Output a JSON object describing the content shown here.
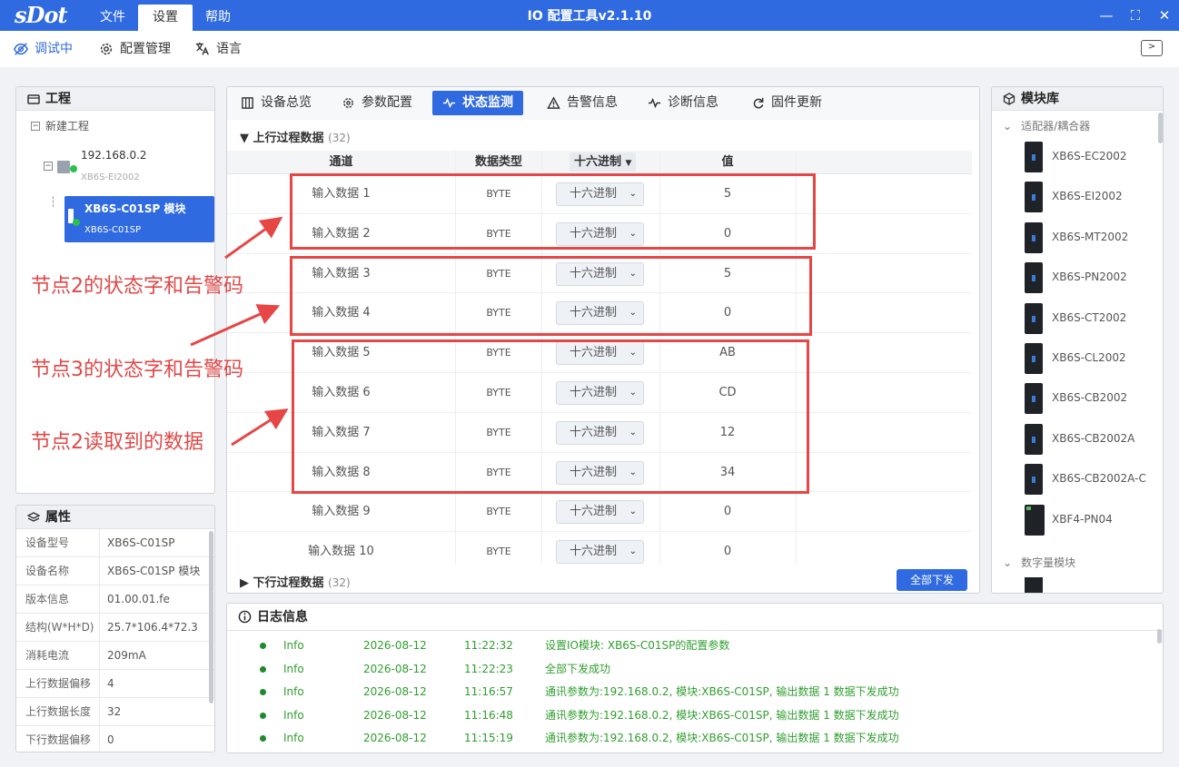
{
  "app": {
    "logo": "sDot",
    "title": "IO 配置工具v2.1.10",
    "menu": [
      "文件",
      "设置",
      "帮助"
    ],
    "window_buttons": [
      "—",
      "⛶",
      "✕"
    ]
  },
  "toolbar": {
    "debug": "调试中",
    "config_mgmt": "配置管理",
    "language": "语言"
  },
  "project": {
    "title": "工程",
    "root": "新建工程",
    "device_ip": "192.168.0.2",
    "device_model": "XB6S-EI2002",
    "module_title": "XB6S-C01SP 模块",
    "module_model": "XB6S-C01SP"
  },
  "properties": {
    "title": "属性",
    "rows": [
      {
        "k": "设备型号",
        "v": "XB6S-C01SP"
      },
      {
        "k": "设备名称",
        "v": "XB6S-C01SP 模块"
      },
      {
        "k": "版本信息",
        "v": "01.00.01.fe"
      },
      {
        "k": "结构(W*H*D)",
        "v": "25.7*106.4*72.3"
      },
      {
        "k": "消耗电流",
        "v": "209mA"
      },
      {
        "k": "上行数据偏移",
        "v": "4"
      },
      {
        "k": "上行数据长度",
        "v": "32"
      },
      {
        "k": "下行数据偏移",
        "v": "0"
      }
    ]
  },
  "tabs": [
    "设备总览",
    "参数配置",
    "状态监测",
    "告警信息",
    "诊断信息",
    "固件更新"
  ],
  "monitor": {
    "upstream_label": "上行过程数据",
    "upstream_count": "(32)",
    "downstream_label": "下行过程数据",
    "downstream_count": "(32)",
    "columns": [
      "通道",
      "数据类型",
      "十六进制",
      "值"
    ],
    "download_all": "全部下发",
    "rows": [
      {
        "ch": "输入数据 1",
        "type": "BYTE",
        "fmt": "十六进制",
        "val": "5"
      },
      {
        "ch": "输入数据 2",
        "type": "BYTE",
        "fmt": "十六进制",
        "val": "0"
      },
      {
        "ch": "输入数据 3",
        "type": "BYTE",
        "fmt": "十六进制",
        "val": "5"
      },
      {
        "ch": "输入数据 4",
        "type": "BYTE",
        "fmt": "十六进制",
        "val": "0"
      },
      {
        "ch": "输入数据 5",
        "type": "BYTE",
        "fmt": "十六进制",
        "val": "AB"
      },
      {
        "ch": "输入数据 6",
        "type": "BYTE",
        "fmt": "十六进制",
        "val": "CD"
      },
      {
        "ch": "输入数据 7",
        "type": "BYTE",
        "fmt": "十六进制",
        "val": "12"
      },
      {
        "ch": "输入数据 8",
        "type": "BYTE",
        "fmt": "十六进制",
        "val": "34"
      },
      {
        "ch": "输入数据 9",
        "type": "BYTE",
        "fmt": "十六进制",
        "val": "0"
      },
      {
        "ch": "输入数据 10",
        "type": "BYTE",
        "fmt": "十六进制",
        "val": "0"
      }
    ]
  },
  "annotations": [
    "节点2的状态字和告警码",
    "节点3的状态字和告警码",
    "节点2读取到的数据"
  ],
  "library": {
    "title": "模块库",
    "category_adapters": "适配器/耦合器",
    "category_digital": "数字量模块",
    "items": [
      "XB6S-EC2002",
      "XB6S-EI2002",
      "XB6S-MT2002",
      "XB6S-PN2002",
      "XB6S-CT2002",
      "XB6S-CL2002",
      "XB6S-CB2002",
      "XB6S-CB2002A",
      "XB6S-CB2002A-C",
      "XBF4-PN04"
    ]
  },
  "log": {
    "title": "日志信息",
    "entries": [
      {
        "level": "Info",
        "date": "2026-08-12",
        "time": "11:22:32",
        "msg": "设置IO模块: XB6S-C01SP的配置参数"
      },
      {
        "level": "Info",
        "date": "2026-08-12",
        "time": "11:22:23",
        "msg": "全部下发成功"
      },
      {
        "level": "Info",
        "date": "2026-08-12",
        "time": "11:16:57",
        "msg": "通讯参数为:192.168.0.2, 模块:XB6S-C01SP, 输出数据 1 数据下发成功"
      },
      {
        "level": "Info",
        "date": "2026-08-12",
        "time": "11:16:48",
        "msg": "通讯参数为:192.168.0.2, 模块:XB6S-C01SP, 输出数据 1 数据下发成功"
      },
      {
        "level": "Info",
        "date": "2026-08-12",
        "time": "11:15:19",
        "msg": "通讯参数为:192.168.0.2, 模块:XB6S-C01SP, 输出数据 1 数据下发成功"
      }
    ]
  },
  "colors": {
    "accent": "#2f6ae0",
    "annotation": "#e04848",
    "log_text": "#2f9e2f"
  }
}
